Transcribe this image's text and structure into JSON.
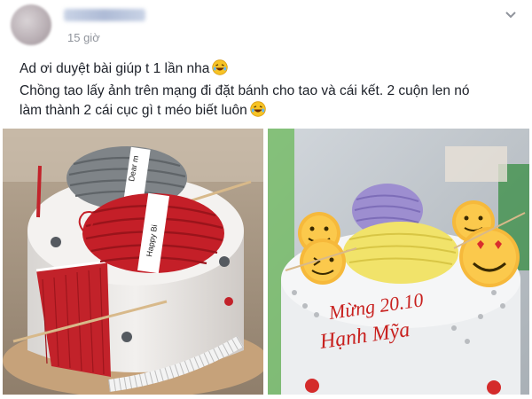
{
  "post": {
    "author": "Thanh Hanh",
    "time": "15 giờ",
    "menu_icon": "chevron-down-icon",
    "lines": [
      "Ad ơi duyệt bài giúp t 1 lần nha",
      "Chồng tao lấy ảnh trên mạng đi đặt bánh cho tao và cái kết. 2 cuộn len nó",
      "làm thành 2 cái cục gì t méo biết luôn"
    ],
    "emoji": "laughing-emoji-icon",
    "photos": {
      "left": {
        "subject": "knitting-cake-reference",
        "yarn_label_gray": "Dear m",
        "yarn_label_red": "Happy Bi"
      },
      "right": {
        "subject": "ordered-cake-result",
        "text_line1": "Mừng 20.10",
        "text_line2": "Hạnh Mỹa"
      }
    }
  },
  "colors": {
    "link_blue": "#385898",
    "meta_gray": "#90949c",
    "emoji_yellow": "#f7c325"
  }
}
